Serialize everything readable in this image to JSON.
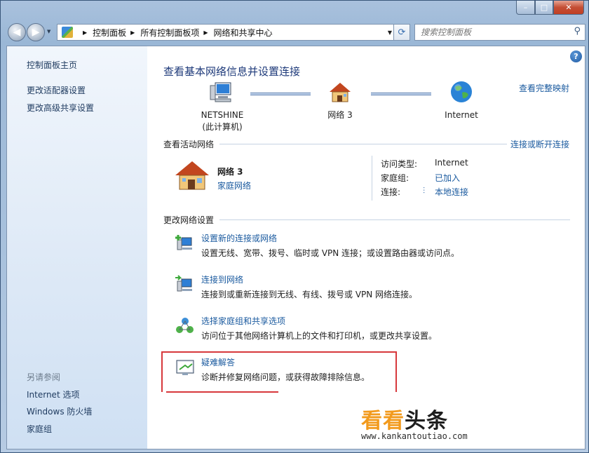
{
  "window": {
    "minimize": "–",
    "maximize": "□",
    "close": "✕"
  },
  "nav": {
    "back": "◀",
    "forward": "▶",
    "breadcrumbs": [
      "控制面板",
      "所有控制面板项",
      "网络和共享中心"
    ],
    "search_placeholder": "搜索控制面板"
  },
  "sidebar": {
    "home": "控制面板主页",
    "items": [
      "更改适配器设置",
      "更改高级共享设置"
    ],
    "see_also_title": "另请参阅",
    "see_also": [
      "Internet 选项",
      "Windows 防火墙",
      "家庭组"
    ]
  },
  "main": {
    "title": "查看基本网络信息并设置连接",
    "view_full_map": "查看完整映射",
    "map": {
      "computer_name": "NETSHINE",
      "computer_sub": "(此计算机)",
      "network": "网络  3",
      "internet": "Internet"
    },
    "active_section": "查看活动网络",
    "connect_disconnect": "连接或断开连接",
    "active": {
      "name": "网络  3",
      "type": "家庭网络",
      "access_type_label": "访问类型:",
      "access_type_value": "Internet",
      "homegroup_label": "家庭组:",
      "homegroup_value": "已加入",
      "connection_label": "连接:",
      "connection_value": "本地连接"
    },
    "change_section": "更改网络设置",
    "tasks": [
      {
        "link": "设置新的连接或网络",
        "desc": "设置无线、宽带、拨号、临时或 VPN 连接；或设置路由器或访问点。"
      },
      {
        "link": "连接到网络",
        "desc": "连接到或重新连接到无线、有线、拨号或 VPN 网络连接。"
      },
      {
        "link": "选择家庭组和共享选项",
        "desc": "访问位于其他网络计算机上的文件和打印机，或更改共享设置。"
      },
      {
        "link": "疑难解答",
        "desc": "诊断并修复网络问题，或获得故障排除信息。"
      }
    ]
  },
  "watermark": {
    "part1": "看看",
    "part2": "头条",
    "url": "www.kankantoutiao.com"
  },
  "colors": {
    "link": "#1a5a9f",
    "highlight_box": "#d7383c",
    "watermark_orange": "#f29a1c"
  }
}
